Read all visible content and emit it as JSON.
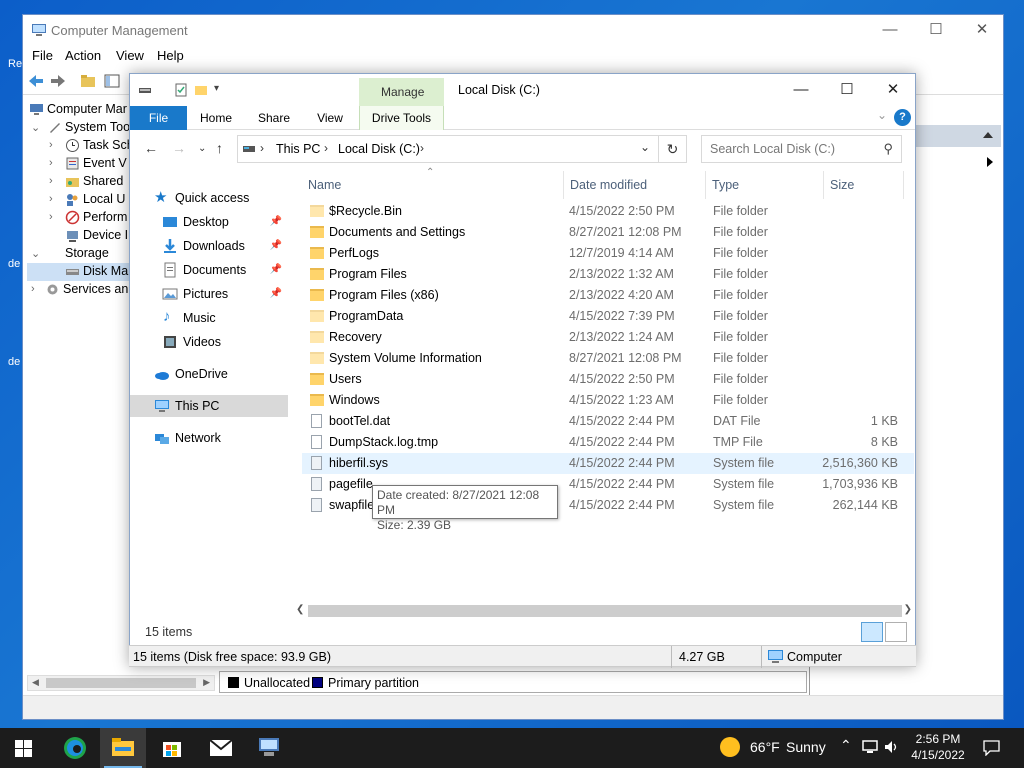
{
  "desktop": {
    "fragments": [
      "Re",
      "de",
      "de"
    ]
  },
  "cm": {
    "title": "Computer Management",
    "menu": [
      "File",
      "Action",
      "View",
      "Help"
    ],
    "tree": [
      {
        "label": "Computer Mar",
        "depth": 0
      },
      {
        "label": "System Too",
        "depth": 1
      },
      {
        "label": "Task Sch",
        "depth": 2
      },
      {
        "label": "Event V",
        "depth": 2
      },
      {
        "label": "Shared",
        "depth": 2
      },
      {
        "label": "Local U",
        "depth": 2
      },
      {
        "label": "Perform",
        "depth": 2
      },
      {
        "label": "Device I",
        "depth": 2
      },
      {
        "label": "Storage",
        "depth": 1
      },
      {
        "label": "Disk Ma",
        "depth": 2
      },
      {
        "label": "Services an",
        "depth": 1
      }
    ],
    "legend": [
      {
        "label": "Unallocated",
        "color": "#000000"
      },
      {
        "label": "Primary partition",
        "color": "#000080"
      }
    ]
  },
  "explorer": {
    "title": "Local Disk (C:)",
    "manage_label": "Manage",
    "tabs": {
      "file": "File",
      "home": "Home",
      "share": "Share",
      "view": "View",
      "drive_tools": "Drive Tools"
    },
    "breadcrumb": [
      "This PC",
      "Local Disk (C:)"
    ],
    "search_placeholder": "Search Local Disk (C:)",
    "nav": [
      {
        "label": "Quick access",
        "icon": "star-icon",
        "pinned": false
      },
      {
        "label": "Desktop",
        "icon": "desktop-icon",
        "pinned": true
      },
      {
        "label": "Downloads",
        "icon": "download-icon",
        "pinned": true
      },
      {
        "label": "Documents",
        "icon": "documents-icon",
        "pinned": true
      },
      {
        "label": "Pictures",
        "icon": "pictures-icon",
        "pinned": true
      },
      {
        "label": "Music",
        "icon": "music-icon",
        "pinned": false
      },
      {
        "label": "Videos",
        "icon": "videos-icon",
        "pinned": false
      },
      {
        "label": "OneDrive",
        "icon": "cloud-icon",
        "pinned": false
      },
      {
        "label": "This PC",
        "icon": "computer-icon",
        "pinned": false
      },
      {
        "label": "Network",
        "icon": "network-icon",
        "pinned": false
      }
    ],
    "columns": {
      "name": "Name",
      "date": "Date modified",
      "type": "Type",
      "size": "Size"
    },
    "files": [
      {
        "name": "$Recycle.Bin",
        "date": "4/15/2022 2:50 PM",
        "type": "File folder",
        "size": "",
        "kind": "folder-faded"
      },
      {
        "name": "Documents and Settings",
        "date": "8/27/2021 12:08 PM",
        "type": "File folder",
        "size": "",
        "kind": "folder-link"
      },
      {
        "name": "PerfLogs",
        "date": "12/7/2019 4:14 AM",
        "type": "File folder",
        "size": "",
        "kind": "folder"
      },
      {
        "name": "Program Files",
        "date": "2/13/2022 1:32 AM",
        "type": "File folder",
        "size": "",
        "kind": "folder"
      },
      {
        "name": "Program Files (x86)",
        "date": "2/13/2022 4:20 AM",
        "type": "File folder",
        "size": "",
        "kind": "folder"
      },
      {
        "name": "ProgramData",
        "date": "4/15/2022 7:39 PM",
        "type": "File folder",
        "size": "",
        "kind": "folder-faded"
      },
      {
        "name": "Recovery",
        "date": "2/13/2022 1:24 AM",
        "type": "File folder",
        "size": "",
        "kind": "folder-faded"
      },
      {
        "name": "System Volume Information",
        "date": "8/27/2021 12:08 PM",
        "type": "File folder",
        "size": "",
        "kind": "folder-faded"
      },
      {
        "name": "Users",
        "date": "4/15/2022 2:50 PM",
        "type": "File folder",
        "size": "",
        "kind": "folder"
      },
      {
        "name": "Windows",
        "date": "4/15/2022 1:23 AM",
        "type": "File folder",
        "size": "",
        "kind": "folder"
      },
      {
        "name": "bootTel.dat",
        "date": "4/15/2022 2:44 PM",
        "type": "DAT File",
        "size": "1 KB",
        "kind": "doc"
      },
      {
        "name": "DumpStack.log.tmp",
        "date": "4/15/2022 2:44 PM",
        "type": "TMP File",
        "size": "8 KB",
        "kind": "doc"
      },
      {
        "name": "hiberfil.sys",
        "date": "4/15/2022 2:44 PM",
        "type": "System file",
        "size": "2,516,360 KB",
        "kind": "sys"
      },
      {
        "name": "pagefile",
        "date": "4/15/2022 2:44 PM",
        "type": "System file",
        "size": "1,703,936 KB",
        "kind": "sys"
      },
      {
        "name": "swapfile",
        "date": "4/15/2022 2:44 PM",
        "type": "System file",
        "size": "262,144 KB",
        "kind": "sys"
      }
    ],
    "hovered_file": "hiberfil.sys",
    "tooltip": {
      "line1": "Date created: 8/27/2021 12:08 PM",
      "line2": "Size: 2.39 GB"
    },
    "item_count": "15 items",
    "status": {
      "left": "15 items (Disk free space: 93.9 GB)",
      "middle": "4.27 GB",
      "right": "Computer"
    }
  },
  "taskbar": {
    "apps": [
      "start-icon",
      "edge-icon",
      "file-explorer-icon",
      "store-icon",
      "mail-icon",
      "computer-management-icon"
    ],
    "weather": {
      "temp": "66°F",
      "condition": "Sunny"
    },
    "time": "2:56 PM",
    "date": "4/15/2022"
  }
}
